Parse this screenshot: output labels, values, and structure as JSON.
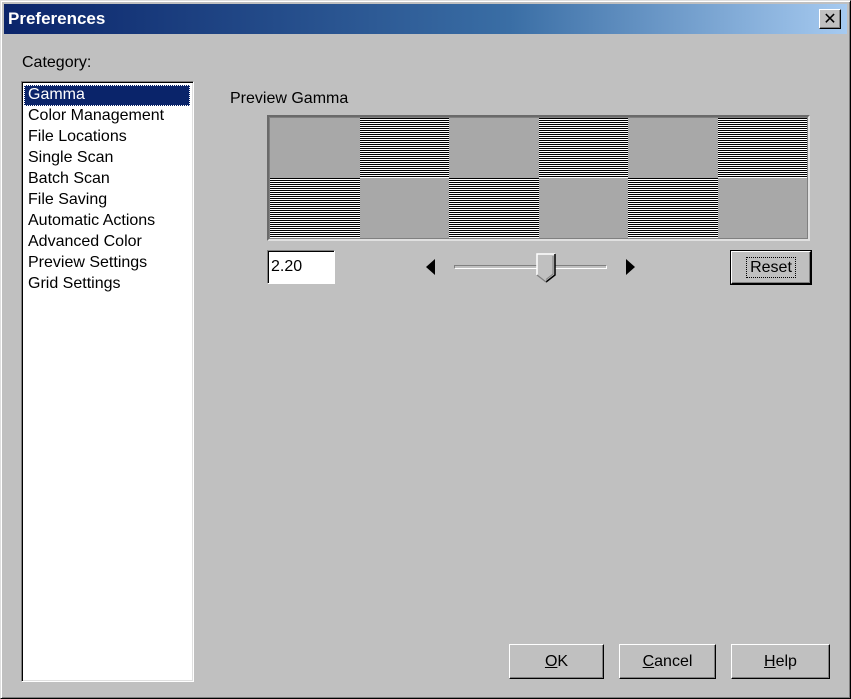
{
  "window": {
    "title": "Preferences",
    "close_glyph": "✕",
    "close_icon": "close-icon"
  },
  "sidebar": {
    "label": "Category:",
    "selected_index": 0,
    "items": [
      {
        "label": "Gamma"
      },
      {
        "label": "Color Management"
      },
      {
        "label": "File Locations"
      },
      {
        "label": "Single Scan"
      },
      {
        "label": "Batch Scan"
      },
      {
        "label": "File Saving"
      },
      {
        "label": "Automatic Actions"
      },
      {
        "label": "Advanced Color"
      },
      {
        "label": "Preview Settings"
      },
      {
        "label": "Grid Settings"
      }
    ]
  },
  "gamma": {
    "section_label": "Preview Gamma",
    "value": "2.20",
    "slider_fraction": 0.6,
    "reset_label": "Reset",
    "pattern": [
      [
        "solid",
        "lines",
        "solid",
        "lines",
        "solid",
        "lines"
      ],
      [
        "lines",
        "solid",
        "lines",
        "solid",
        "lines",
        "solid"
      ]
    ]
  },
  "footer": {
    "ok_label": "OK",
    "cancel_label": "Cancel",
    "help_label": "Help"
  },
  "colors": {
    "title_gradient_start": "#0a246a",
    "title_gradient_end": "#a6caf0",
    "selection": "#0a246a",
    "face": "#c0c0c0"
  }
}
